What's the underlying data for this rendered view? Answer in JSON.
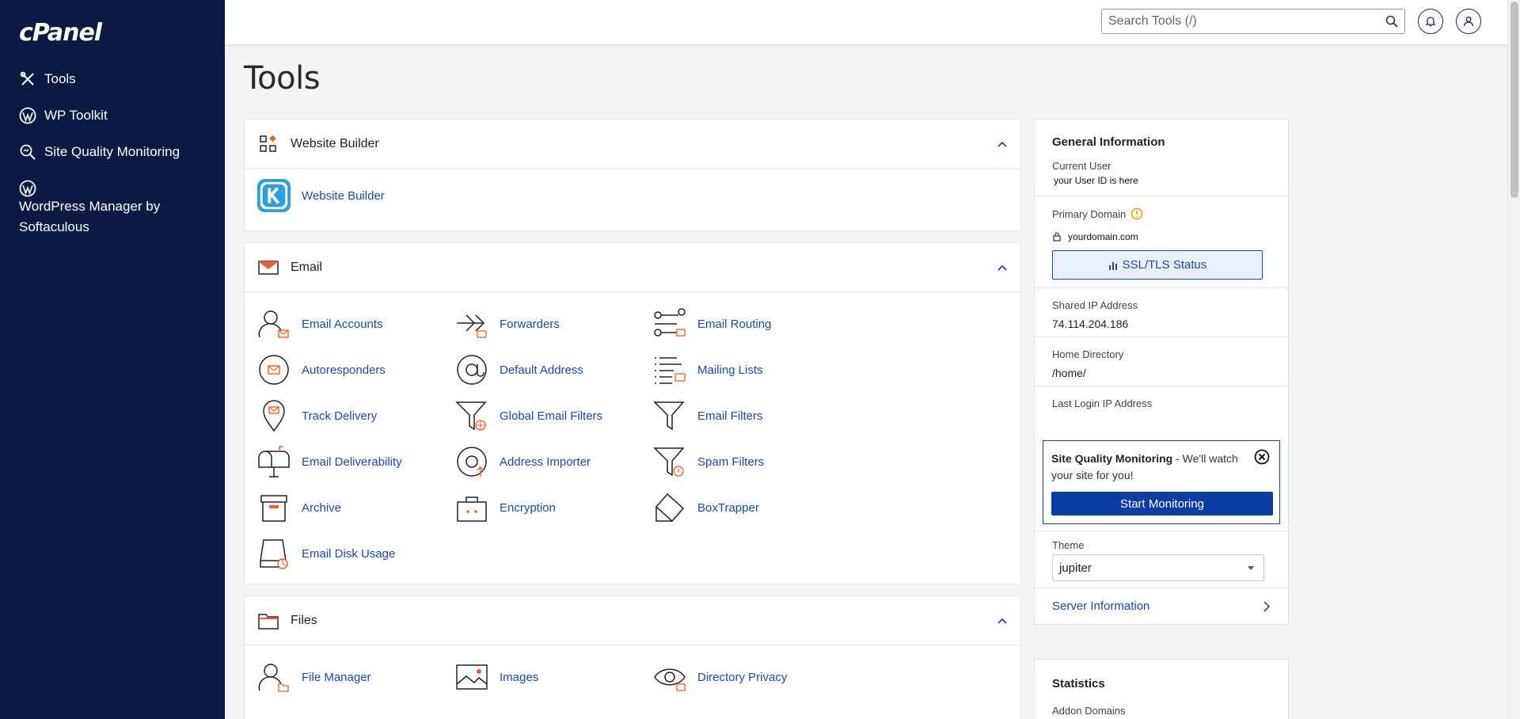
{
  "brand": {
    "logo_text": "cPanel"
  },
  "sidebar": {
    "items": [
      {
        "label": "Tools",
        "icon": "tools-icon"
      },
      {
        "label": "WP Toolkit",
        "icon": "wordpress-icon"
      },
      {
        "label": "Site Quality Monitoring",
        "icon": "magnifier-icon"
      },
      {
        "label_line1": "WordPress Manager by",
        "label_line2": "Softaculous",
        "icon": "wordpress-icon"
      }
    ]
  },
  "topbar": {
    "search_placeholder": "Search Tools (/)"
  },
  "page": {
    "title": "Tools"
  },
  "panels": {
    "website_builder": {
      "title": "Website Builder",
      "tools": [
        {
          "label": "Website Builder"
        }
      ]
    },
    "email": {
      "title": "Email",
      "tools": [
        {
          "label": "Email Accounts"
        },
        {
          "label": "Forwarders"
        },
        {
          "label": "Email Routing"
        },
        {
          "label": "Autoresponders"
        },
        {
          "label": "Default Address"
        },
        {
          "label": "Mailing Lists"
        },
        {
          "label": "Track Delivery"
        },
        {
          "label": "Global Email Filters"
        },
        {
          "label": "Email Filters"
        },
        {
          "label": "Email Deliverability"
        },
        {
          "label": "Address Importer"
        },
        {
          "label": "Spam Filters"
        },
        {
          "label": "Archive"
        },
        {
          "label": "Encryption"
        },
        {
          "label": "BoxTrapper"
        },
        {
          "label": "Email Disk Usage"
        }
      ]
    },
    "files": {
      "title": "Files",
      "tools": [
        {
          "label": "File Manager"
        },
        {
          "label": "Images"
        },
        {
          "label": "Directory Privacy"
        }
      ]
    }
  },
  "general_info": {
    "title": "General Information",
    "current_user_label": "Current User",
    "current_user_value": "your User ID is here",
    "primary_domain_label": "Primary Domain",
    "primary_domain_value": "yourdomain.com",
    "ssl_button": "SSL/TLS Status",
    "shared_ip_label": "Shared IP Address",
    "shared_ip_value": "74.114.204.186",
    "home_dir_label": "Home Directory",
    "home_dir_value": "/home/",
    "last_login_label": "Last Login IP Address",
    "sqm_bold": "Site Quality Monitoring",
    "sqm_text": " - We'll watch your site for you!",
    "sqm_button": "Start Monitoring",
    "theme_label": "Theme",
    "theme_value": "jupiter",
    "server_info_link": "Server Information"
  },
  "statistics": {
    "title": "Statistics",
    "first_label": "Addon Domains"
  },
  "colors": {
    "sidebar_bg": "#0b1a45",
    "link_blue": "#1f4aa0",
    "accent_orange": "#e8612c",
    "primary_button": "#0b3da5"
  }
}
